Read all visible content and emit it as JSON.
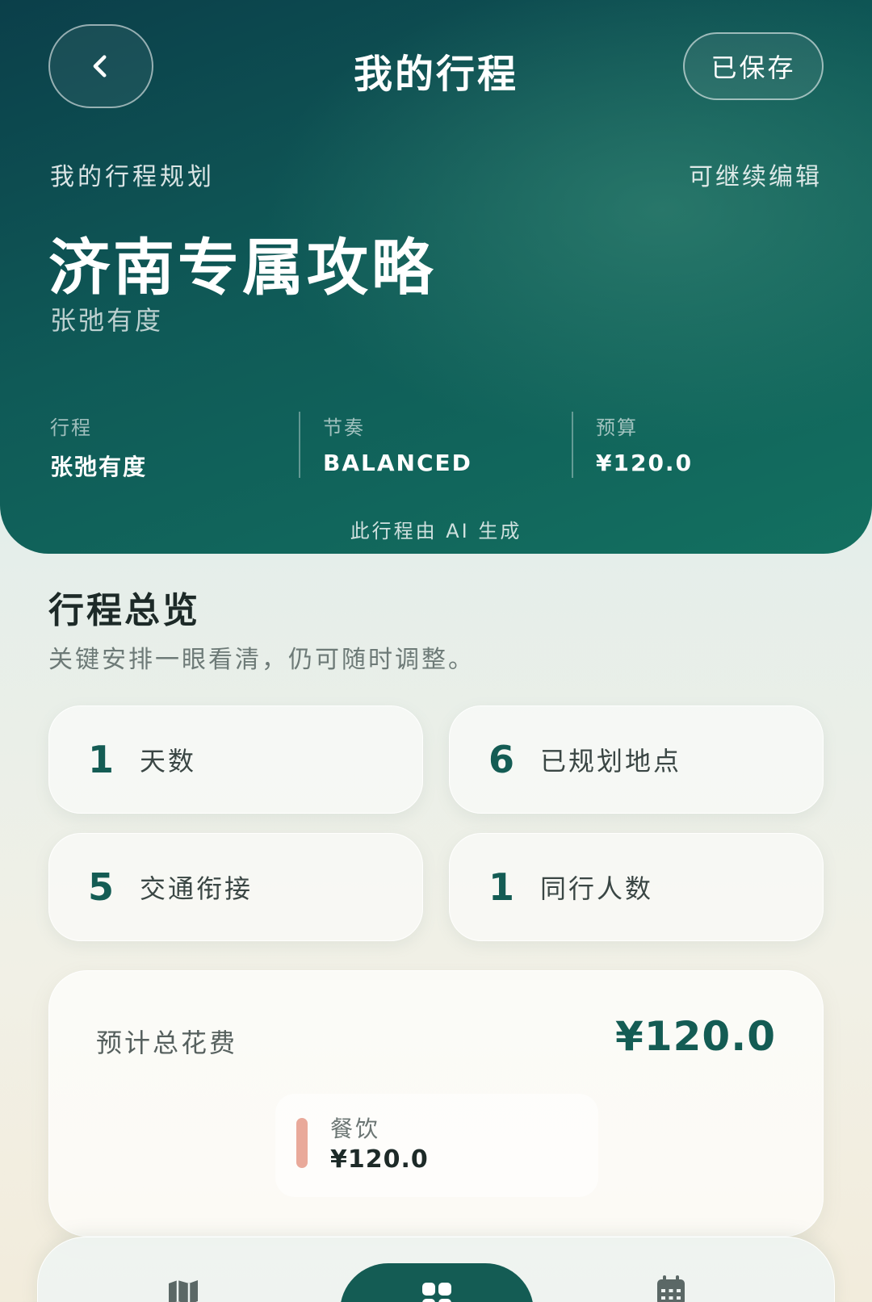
{
  "header": {
    "back_icon": "chevron-left-icon",
    "title": "我的行程",
    "saved_label": "已保存"
  },
  "hero": {
    "subtitle": "我的行程规划",
    "edit_hint": "可继续编辑",
    "title": "济南专属攻略",
    "tagline": "张弛有度",
    "stats": [
      {
        "label": "行程",
        "value": "张弛有度"
      },
      {
        "label": "节奏",
        "value": "BALANCED"
      },
      {
        "label": "预算",
        "value": "¥120.0"
      }
    ],
    "ai_note": "此行程由 AI 生成"
  },
  "overview": {
    "title": "行程总览",
    "subtitle": "关键安排一眼看清，仍可随时调整。",
    "metrics": [
      {
        "value": "1",
        "label": "天数"
      },
      {
        "value": "6",
        "label": "已规划地点"
      },
      {
        "value": "5",
        "label": "交通衔接"
      },
      {
        "value": "1",
        "label": "同行人数"
      }
    ]
  },
  "cost": {
    "label": "预计总花费",
    "total": "¥120.0",
    "items": [
      {
        "name": "餐饮",
        "value": "¥120.0",
        "color": "#e9a99a"
      }
    ]
  },
  "bottom_nav": {
    "items": [
      {
        "icon": "map-icon",
        "active": false
      },
      {
        "icon": "grid-icon",
        "active": true
      },
      {
        "icon": "calendar-icon",
        "active": false
      }
    ]
  },
  "colors": {
    "hero_dark": "#0b3f4a",
    "hero_green": "#137060",
    "accent": "#145c54",
    "food_bar": "#e9a99a"
  }
}
